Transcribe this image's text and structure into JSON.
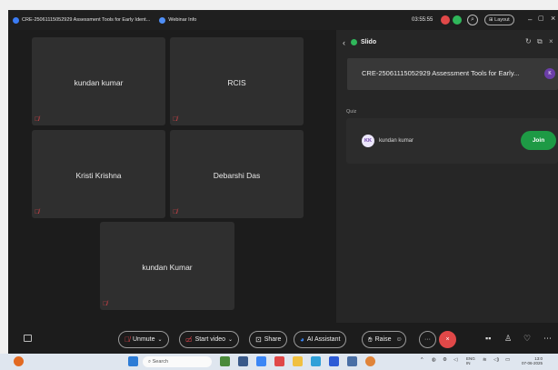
{
  "window": {
    "title": "CRE-25061115052929 Assessment Tools for Early Ident...",
    "webinar_label": "Webinar Info",
    "timer": "03:55:55",
    "layout_label": "Layout"
  },
  "participants": [
    {
      "name": "kundan kumar",
      "muted": true
    },
    {
      "name": "RCIS",
      "muted": true
    },
    {
      "name": "Kristi Krishna",
      "muted": true
    },
    {
      "name": "Debarshi Das",
      "muted": true
    },
    {
      "name": "kundan Kumar",
      "muted": true
    }
  ],
  "slido": {
    "title": "Slido",
    "event_title": "CRE-25061115052929 Assessment Tools for Early...",
    "event_avatar": "K",
    "section_label": "Quiz",
    "quiz": {
      "avatar": "KK",
      "name": "kundan kumar",
      "join_label": "Join"
    }
  },
  "toolbar": {
    "unmute_label": "Unmute",
    "video_label": "Start video",
    "share_label": "Share",
    "ai_label": "AI Assistant",
    "raise_label": "Raise"
  },
  "taskbar": {
    "search_placeholder": "Search",
    "lang": "ENG",
    "region": "IN",
    "time": "13:0",
    "date": "07-06-2025"
  },
  "colors": {
    "mute_red": "#e0454b",
    "join_green": "#1e9a45",
    "end_red": "#e04848",
    "slido_green": "#2fb65a"
  }
}
